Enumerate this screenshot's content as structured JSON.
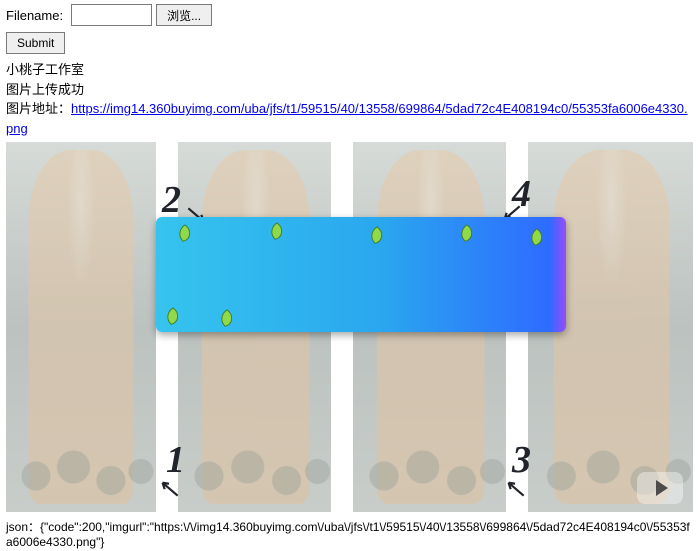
{
  "form": {
    "filename_label": "Filename:",
    "browse_label": "浏览...",
    "submit_label": "Submit",
    "filename_value": ""
  },
  "result": {
    "studio": "小桃子工作室",
    "upload_ok": "图片上传成功",
    "addr_label": "图片地址：",
    "url": "https://img14.360buyimg.com/uba/jfs/t1/59515/40/13558/699864/5dad72c4E408194c0/55353fa6006e4330.png"
  },
  "numbers": {
    "n1": "1",
    "n2": "2",
    "n3": "3",
    "n4": "4"
  },
  "json_label": "json：",
  "json_body": "{\"code\":200,\"imgurl\":\"https:\\/\\/img14.360buyimg.com\\/uba\\/jfs\\/t1\\/59515\\/40\\/13558\\/699864\\/5dad72c4E408194c0\\/55353fa6006e4330.png\"}"
}
